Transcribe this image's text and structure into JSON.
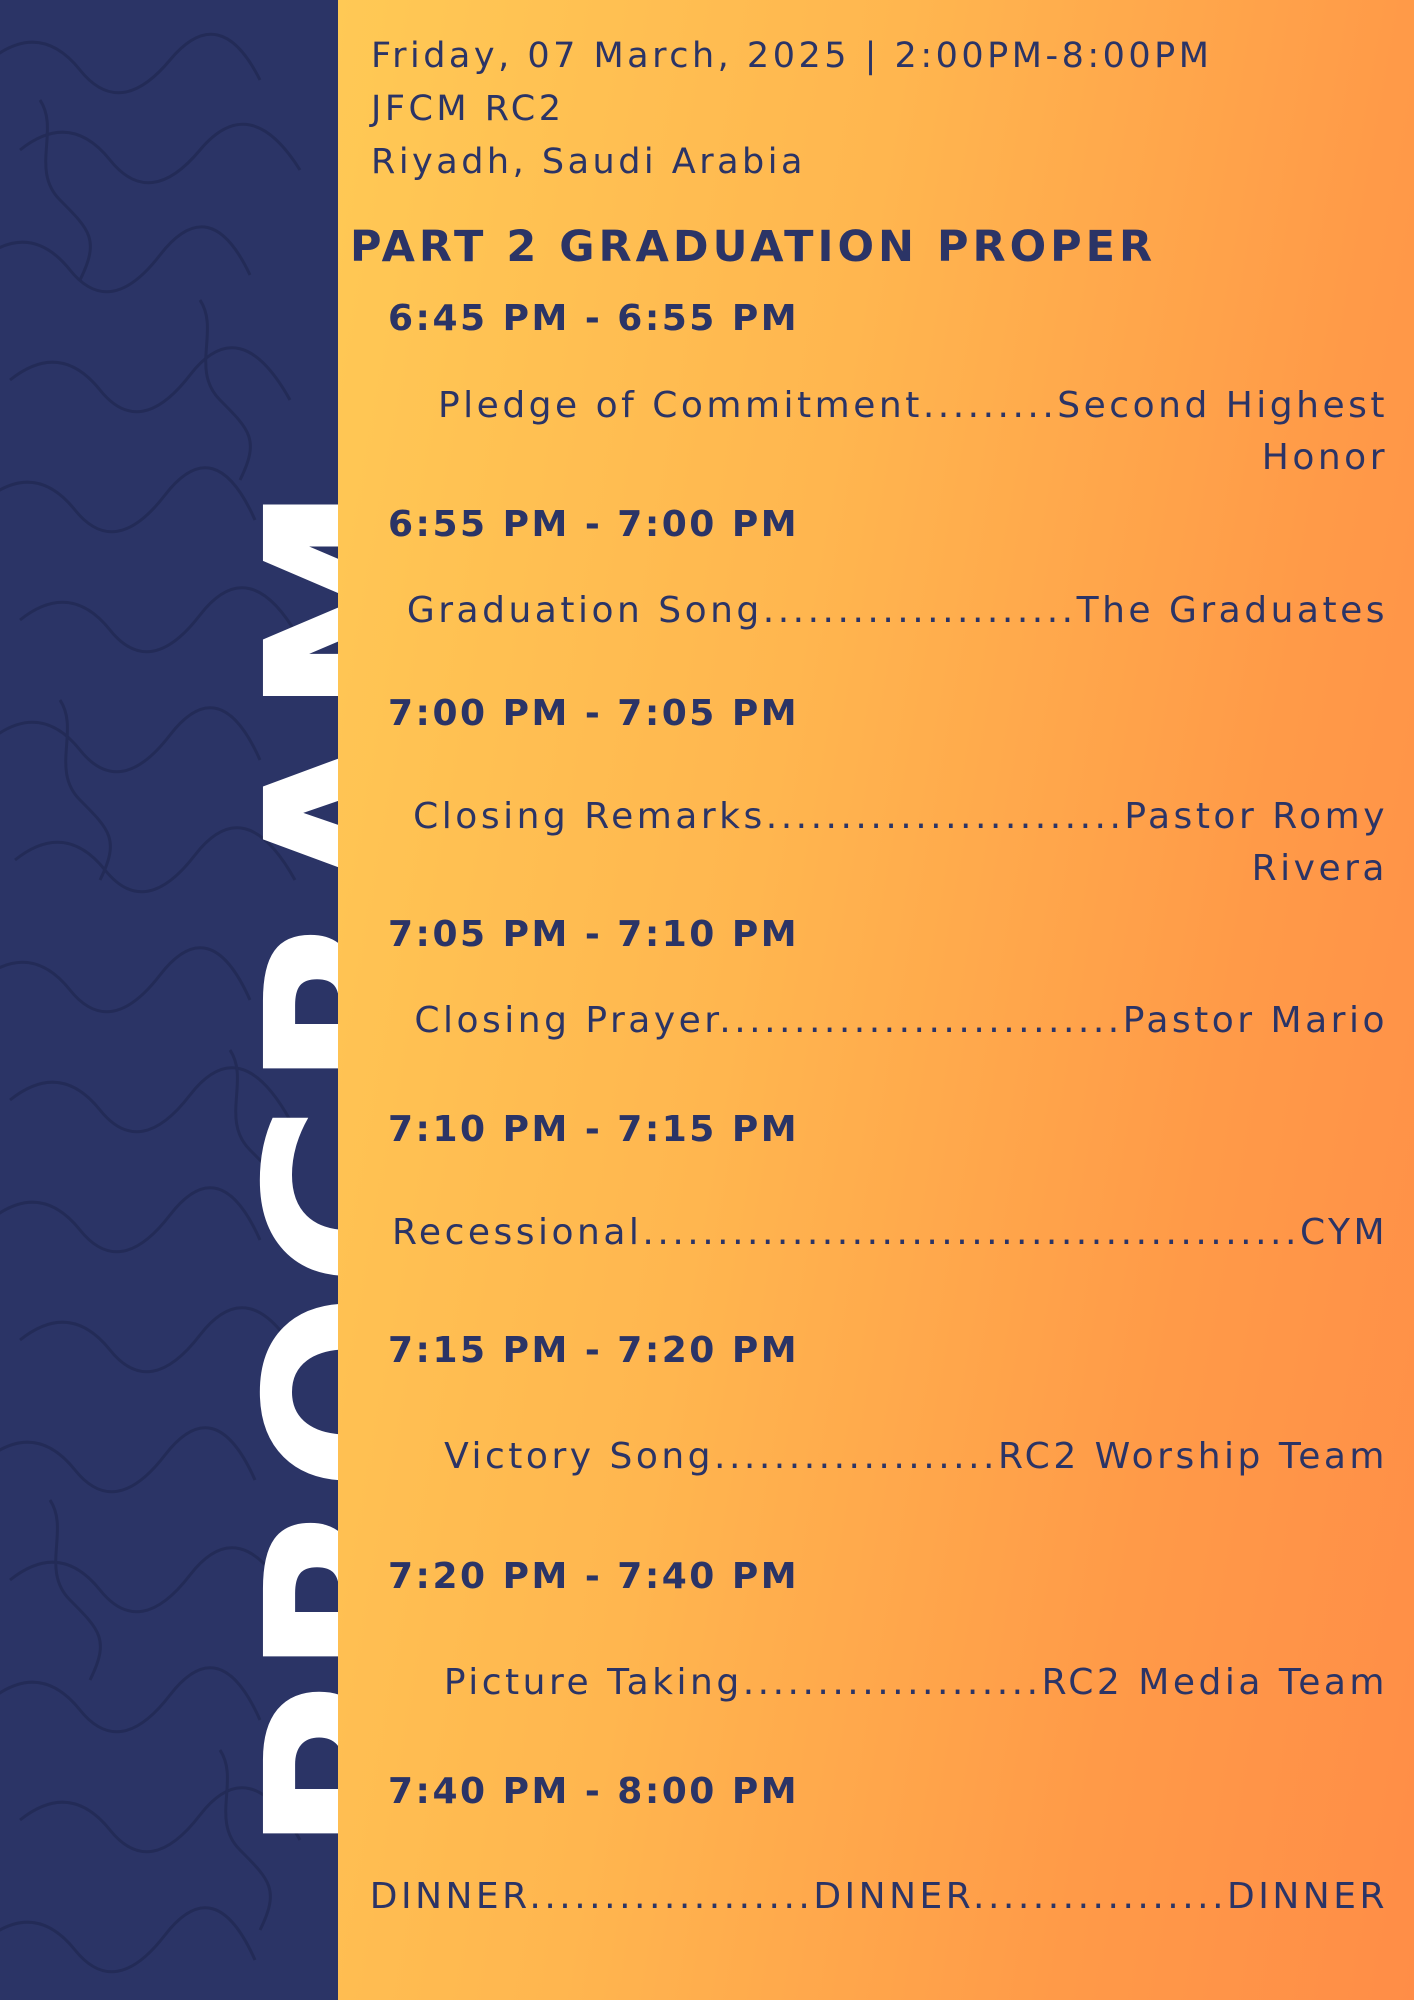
{
  "colors": {
    "navy": "#2b3466",
    "gradient_start": "#ffc955",
    "gradient_end": "#ff8d47",
    "title_text": "#ffffff"
  },
  "sidebar": {
    "title": "PROGRAM"
  },
  "event": {
    "date_time": "Friday, 07 March, 2025 | 2:00PM-8:00PM",
    "venue": "JFCM RC2",
    "location": "Riyadh, Saudi Arabia"
  },
  "section_title": "PART 2 GRADUATION PROPER",
  "schedule": [
    {
      "time": "6:45 PM - 6:55 PM",
      "line1": "Pledge of Commitment.........Second Highest",
      "line2": "Honor"
    },
    {
      "time": "6:55 PM - 7:00 PM",
      "line1": "Graduation Song.....................The Graduates",
      "line2": ""
    },
    {
      "time": "7:00 PM - 7:05 PM",
      "line1": "Closing Remarks........................Pastor Romy",
      "line2": "Rivera"
    },
    {
      "time": "7:05 PM - 7:10 PM",
      "line1": "Closing Prayer...........................Pastor Mario",
      "line2": ""
    },
    {
      "time": "7:10 PM - 7:15 PM",
      "line1": "Recessional............................................CYM",
      "line2": ""
    },
    {
      "time": "7:15 PM - 7:20 PM",
      "line1": "Victory Song...................RC2 Worship Team",
      "line2": ""
    },
    {
      "time": "7:20 PM - 7:40 PM",
      "line1": "Picture Taking....................RC2 Media Team",
      "line2": ""
    },
    {
      "time": "7:40 PM - 8:00 PM",
      "line1": "DINNER...................DINNER.................DINNER",
      "line2": ""
    }
  ]
}
